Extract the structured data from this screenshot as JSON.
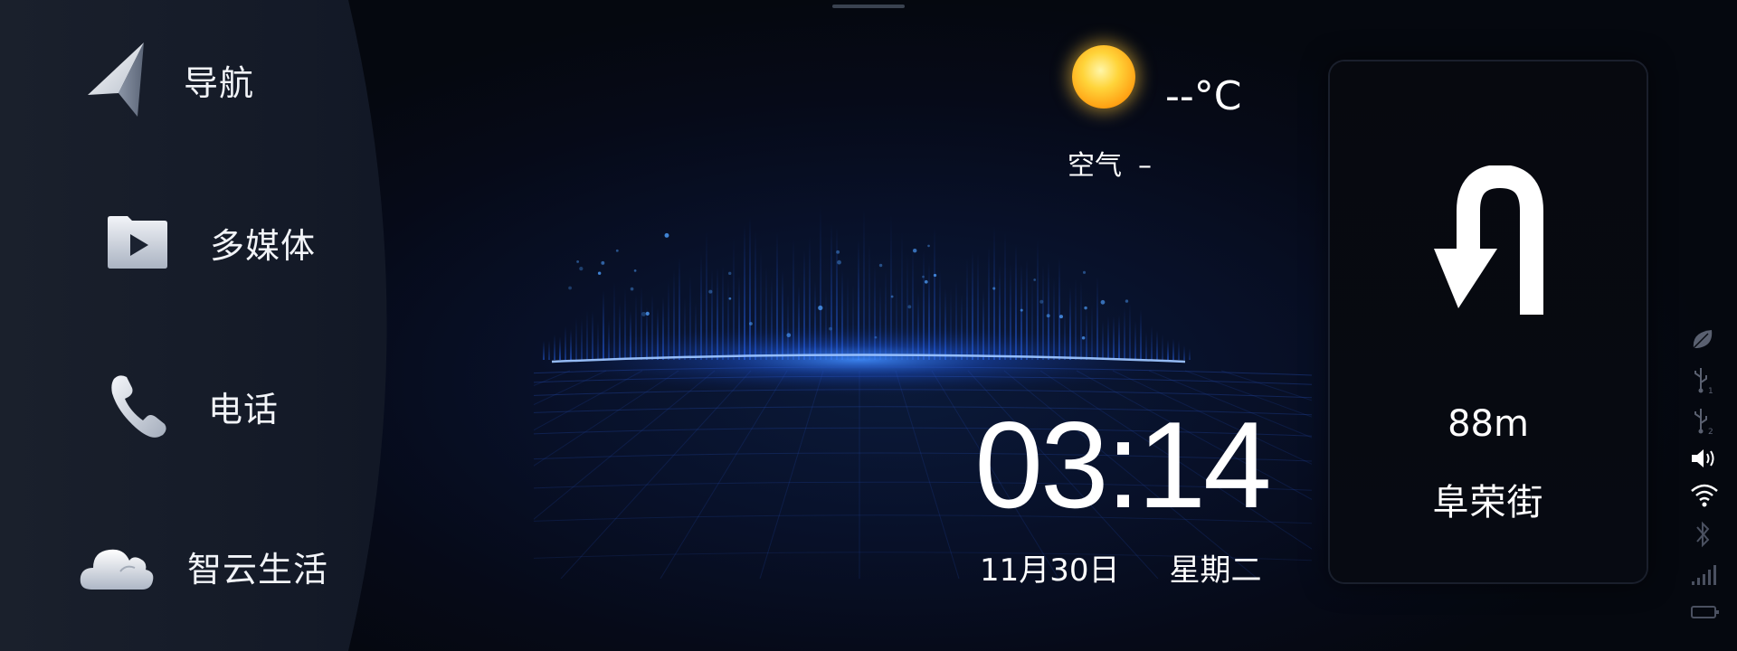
{
  "menu": {
    "items": [
      {
        "id": "nav",
        "label": "导航",
        "icon": "navigation-arrow-icon"
      },
      {
        "id": "media",
        "label": "多媒体",
        "icon": "media-folder-play-icon"
      },
      {
        "id": "phone",
        "label": "电话",
        "icon": "phone-handset-icon"
      },
      {
        "id": "life",
        "label": "智云生活",
        "icon": "cloud-icon"
      }
    ]
  },
  "weather": {
    "icon": "sun-icon",
    "temperature": "--°C",
    "air_label": "空气",
    "air_value": "–"
  },
  "clock": {
    "time": "03:14",
    "date": "11月30日",
    "weekday": "星期二"
  },
  "navigation": {
    "maneuver_icon": "u-turn-icon",
    "distance": "88m",
    "street": "阜荣街"
  },
  "status": {
    "icons": [
      "leaf-icon",
      "usb-1-icon",
      "usb-2-icon",
      "volume-icon",
      "wifi-icon",
      "bluetooth-icon",
      "signal-icon",
      "battery-icon"
    ]
  },
  "colors": {
    "accent_blue": "#1e6cff",
    "panel": "#151b28",
    "background": "#070b16",
    "sun": "#ffc21f"
  }
}
